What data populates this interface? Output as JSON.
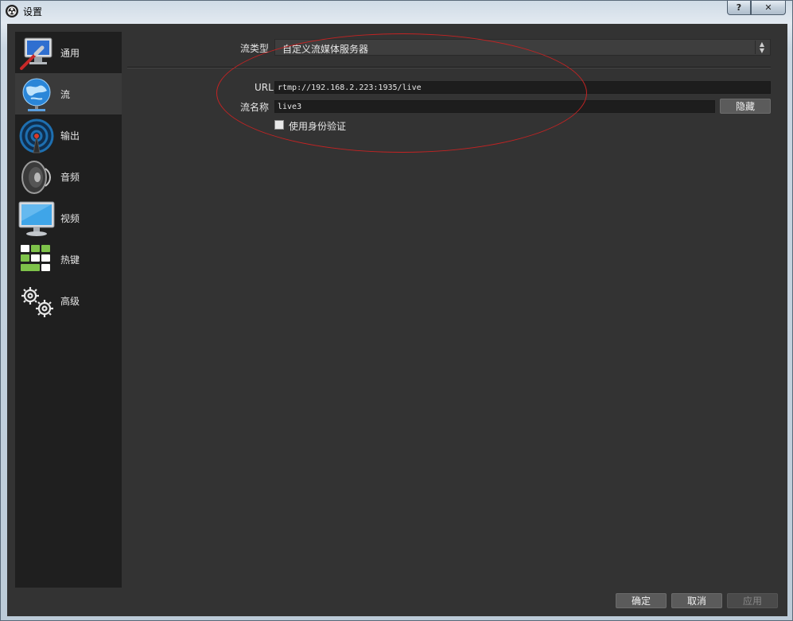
{
  "window": {
    "title": "设置",
    "help_label": "?",
    "close_label": "✕"
  },
  "sidebar": {
    "items": [
      {
        "label": "通用",
        "icon": "wrench-monitor-icon"
      },
      {
        "label": "流",
        "icon": "globe-icon"
      },
      {
        "label": "输出",
        "icon": "broadcast-icon"
      },
      {
        "label": "音频",
        "icon": "speaker-icon"
      },
      {
        "label": "视频",
        "icon": "monitor-icon"
      },
      {
        "label": "热键",
        "icon": "keyboard-icon"
      },
      {
        "label": "高级",
        "icon": "gears-icon"
      }
    ],
    "active_index": 1
  },
  "stream": {
    "type_label": "流类型",
    "type_value": "自定义流媒体服务器",
    "url_label": "URL",
    "url_value": "rtmp://192.168.2.223:1935/live",
    "key_label": "流名称",
    "key_value": "live3",
    "hide_button": "隐藏",
    "auth_label": "使用身份验证"
  },
  "footer": {
    "ok": "确定",
    "cancel": "取消",
    "apply": "应用"
  },
  "colors": {
    "client_bg": "#333333",
    "sidebar_bg": "#1f1f1f",
    "annotation": "#c42323"
  }
}
